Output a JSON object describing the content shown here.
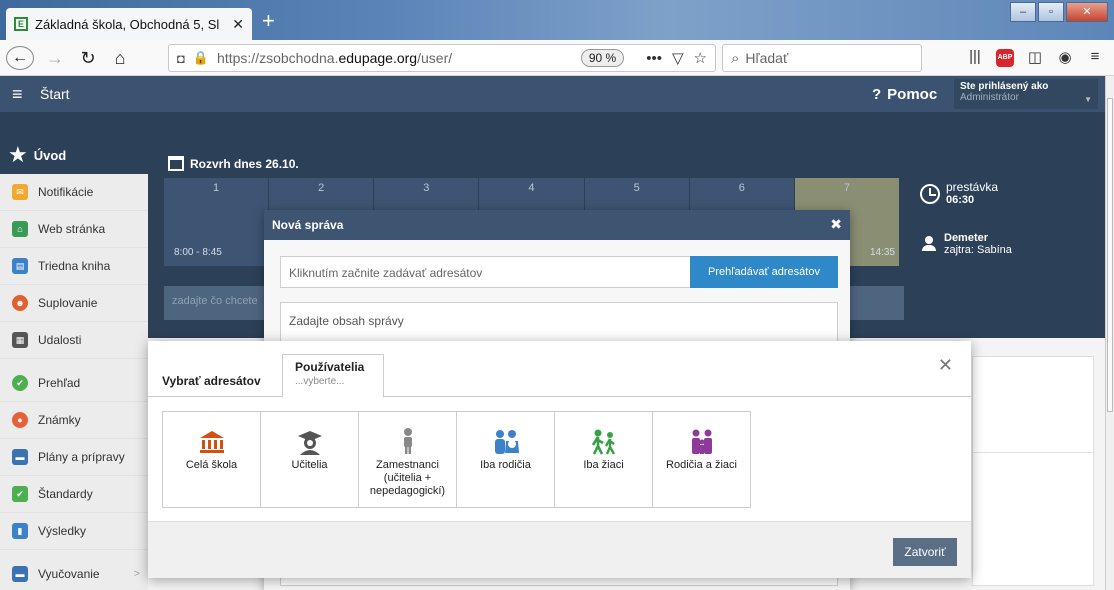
{
  "browser": {
    "tab_title": "Základná škola, Obchodná 5, Sl",
    "tab_favicon": "E",
    "url_prefix": "https://zsobchodna.",
    "url_domain": "edupage.org",
    "url_suffix": "/user/",
    "zoom": "90 %",
    "search_placeholder": "Hľadať"
  },
  "header": {
    "start": "Štart",
    "help": "Pomoc",
    "logged_in_label": "Ste prihlásený ako",
    "logged_in_role": "Administrátor"
  },
  "sidebar": {
    "head": "Úvod",
    "group1": [
      {
        "label": "Notifikácie",
        "icon": "envelope-icon",
        "color": "#f0a830"
      },
      {
        "label": "Web stránka",
        "icon": "home-icon",
        "color": "#3a9a58"
      },
      {
        "label": "Triedna kniha",
        "icon": "book-icon",
        "color": "#3b82c9"
      },
      {
        "label": "Suplovanie",
        "icon": "person-swap-icon",
        "color": "#e06030"
      },
      {
        "label": "Udalosti",
        "icon": "calendar-icon",
        "color": "#555555"
      }
    ],
    "group2": [
      {
        "label": "Prehľad",
        "icon": "check-circle-icon",
        "color": "#4caf50"
      },
      {
        "label": "Známky",
        "icon": "grade-icon",
        "color": "#e8603a"
      },
      {
        "label": "Plány a prípravy",
        "icon": "folder-icon",
        "color": "#3b73b0"
      },
      {
        "label": "Štandardy",
        "icon": "shield-check-icon",
        "color": "#4caf50"
      },
      {
        "label": "Výsledky",
        "icon": "bar-chart-icon",
        "color": "#3b82c9"
      }
    ],
    "group3": [
      {
        "label": "Vyučovanie",
        "icon": "teaching-icon",
        "color": "#3b73b0"
      }
    ]
  },
  "schedule": {
    "title": "Rozvrh dnes 26.10.",
    "periods": [
      "1",
      "2",
      "3",
      "4",
      "5",
      "6",
      "7"
    ],
    "first_time": "8:00 - 8:45",
    "last_time": "14:35",
    "break_label": "prestávka",
    "break_time": "06:30",
    "duty_name": "Demeter",
    "duty_next": "zajtra: Sabína",
    "search_placeholder": "zadajte čo chcete"
  },
  "message": {
    "title": "Nová správa",
    "recipients_placeholder": "Kliknutím začnite zadávať adresátov",
    "browse_button": "Prehľadávať adresátov",
    "body_placeholder": "Zadajte obsah správy"
  },
  "picker": {
    "title": "Vybrať adresátov",
    "tab_label": "Používatelia",
    "tab_sub": "...vyberte...",
    "close_button": "Zatvoriť",
    "tiles": [
      {
        "label": "Celá škola",
        "icon": "school-building-icon",
        "color": "#d4500e"
      },
      {
        "label": "Učitelia",
        "icon": "teacher-icon",
        "color": "#555555"
      },
      {
        "label": "Zamestnanci (učitelia + nepedagogickí)",
        "icon": "employee-icon",
        "color": "#888888"
      },
      {
        "label": "Iba rodičia",
        "icon": "parents-icon",
        "color": "#3b82c9"
      },
      {
        "label": "Iba žiaci",
        "icon": "students-icon",
        "color": "#3aa048"
      },
      {
        "label": "Rodičia a žiaci",
        "icon": "family-icon",
        "color": "#8e3a9a"
      }
    ]
  }
}
